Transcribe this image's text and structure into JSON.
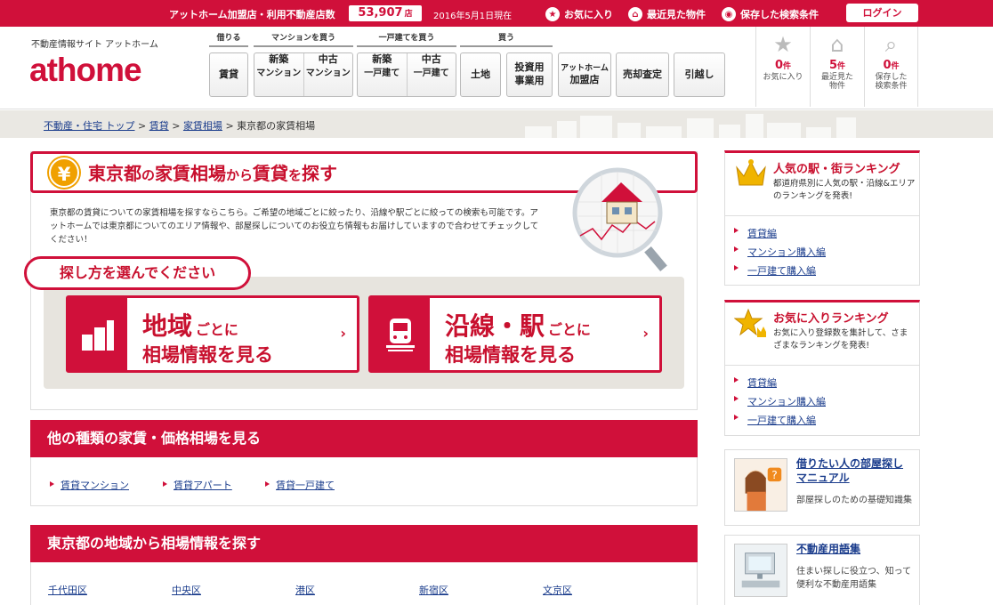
{
  "topbar": {
    "count_label": "アットホーム加盟店・利用不動産店数",
    "count_value": "53,907",
    "count_unit": "店",
    "date": "2016年5月1日現在",
    "favorites": "お気に入り",
    "recent": "最近見た物件",
    "saved": "保存した検索条件",
    "login": "ログイン"
  },
  "header": {
    "tagline": "不動産情報サイト アットホーム",
    "logo": "athome",
    "groups": {
      "rent": "借りる",
      "mansion": "マンションを買う",
      "house": "一戸建てを買う",
      "buy": "買う"
    },
    "nav": {
      "chintai": "賃貸",
      "shinchiku_mansion_a": "新築",
      "shinchiku_mansion_b": "マンション",
      "chuko_mansion_a": "中古",
      "chuko_mansion_b": "マンション",
      "shinchiku_house_a": "新築",
      "shinchiku_house_b": "一戸建て",
      "chuko_house_a": "中古",
      "chuko_house_b": "一戸建て",
      "tochi": "土地",
      "toushi_a": "投資用",
      "toushi_b": "事業用",
      "kamei_a": "アットホーム",
      "kamei_b": "加盟店",
      "baikyaku": "売却査定",
      "hikkoshi": "引越し"
    },
    "history": [
      {
        "count": "0",
        "unit": "件",
        "label1": "お気に入り",
        "label2": ""
      },
      {
        "count": "5",
        "unit": "件",
        "label1": "最近見た",
        "label2": "物件"
      },
      {
        "count": "0",
        "unit": "件",
        "label1": "保存した",
        "label2": "検索条件"
      }
    ]
  },
  "breadcrumb": {
    "top": "不動産・住宅 トップ",
    "chintai": "賃貸",
    "souba": "家賃相場",
    "current": "東京都の家賃相場",
    "sep": ">"
  },
  "main": {
    "title_a": "東京都",
    "title_b": "の",
    "title_c": "家賃相場",
    "title_d": "から",
    "title_e": "賃貸",
    "title_f": "を",
    "title_g": "探す",
    "description": "東京都の賃貸についての家賃相場を探すならこちら。ご希望の地域ごとに絞ったり、沿線や駅ごとに絞っての検索も可能です。アットホームでは東京都についてのエリア情報や、部屋探しについてのお役立ち情報もお届けしていますので合わせてチェックしてください！",
    "method_heading": "探し方を選んでください",
    "card_area": {
      "big": "地域",
      "small": "ごとに",
      "line2": "相場情報を見る"
    },
    "card_line": {
      "big": "沿線・駅",
      "small": "ごとに",
      "line2": "相場情報を見る"
    },
    "arrow": "›"
  },
  "other_section": {
    "heading": "他の種類の家賃・価格相場を見る",
    "links": [
      "賃貸マンション",
      "賃貸アパート",
      "賃貸一戸建て"
    ]
  },
  "area_section": {
    "heading": "東京都の地域から相場情報を探す",
    "links": [
      "千代田区",
      "中央区",
      "港区",
      "新宿区",
      "文京区"
    ]
  },
  "sidebar": {
    "ranking1": {
      "title": "人気の駅・街ランキング",
      "desc": "都道府県別に人気の駅・沿線&エリアのランキングを発表!",
      "links": [
        "賃貸編",
        "マンション購入編",
        "一戸建て購入編"
      ]
    },
    "ranking2": {
      "title": "お気に入りランキング",
      "desc": "お気に入り登録数を集計して、さまざまなランキングを発表!",
      "links": [
        "賃貸編",
        "マンション購入編",
        "一戸建て購入編"
      ]
    },
    "guide1": {
      "title": "借りたい人の部屋探しマニュアル",
      "desc": "部屋探しのための基礎知識集"
    },
    "guide2": {
      "title": "不動産用語集",
      "desc": "住まい探しに役立つ、知って便利な不動産用語集"
    }
  },
  "colors": {
    "brand": "#d0103a",
    "link": "#1a3c8c",
    "accent_gold": "#f0a000"
  }
}
